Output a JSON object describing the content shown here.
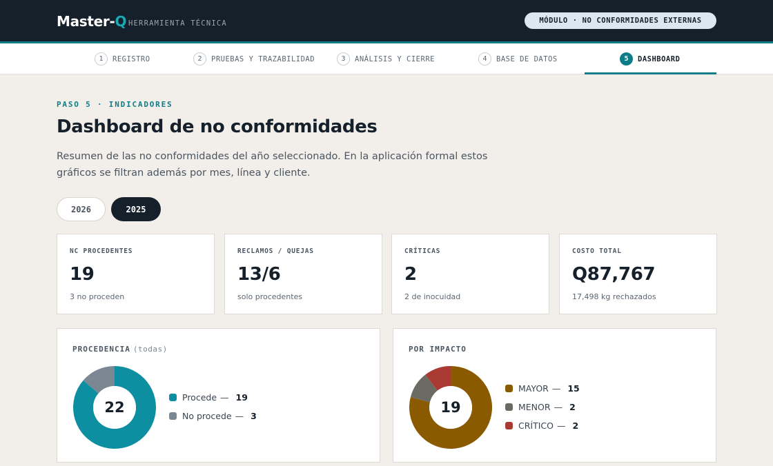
{
  "header": {
    "brand_main": "Master-",
    "brand_q": "Q",
    "brand_sub": "HERRAMIENTA TÉCNICA",
    "module": "MÓDULO · NO CONFORMIDADES EXTERNAS"
  },
  "steps": [
    {
      "num": "1",
      "label": "REGISTRO",
      "active": false
    },
    {
      "num": "2",
      "label": "PRUEBAS Y TRAZABILIDAD",
      "active": false
    },
    {
      "num": "3",
      "label": "ANÁLISIS Y CIERRE",
      "active": false
    },
    {
      "num": "4",
      "label": "BASE DE DATOS",
      "active": false
    },
    {
      "num": "5",
      "label": "DASHBOARD",
      "active": true
    }
  ],
  "page": {
    "eyebrow": "PASO 5 · INDICADORES",
    "title": "Dashboard de no conformidades",
    "description": "Resumen de las no conformidades del año seleccionado. En la aplicación formal estos gráficos se filtran además por mes, línea y cliente."
  },
  "years": [
    {
      "label": "2026",
      "selected": false
    },
    {
      "label": "2025",
      "selected": true
    }
  ],
  "kpis": [
    {
      "label": "NC PROCEDENTES",
      "value": "19",
      "sub": "3 no proceden"
    },
    {
      "label": "RECLAMOS / QUEJAS",
      "value": "13/6",
      "sub": "solo procedentes"
    },
    {
      "label": "CRÍTICAS",
      "value": "2",
      "sub": "2 de inocuidad"
    },
    {
      "label": "COSTO TOTAL",
      "value": "Q87,767",
      "sub": "17,498 kg rechazados"
    }
  ],
  "chart_data": [
    {
      "type": "pie",
      "title": "PROCEDENCIA",
      "title_hint": "(todas)",
      "center_label": "22",
      "slices": [
        {
          "name": "Procede",
          "value": 19,
          "color": "#0e8fa1"
        },
        {
          "name": "No procede",
          "value": 3,
          "color": "#7c8794"
        }
      ]
    },
    {
      "type": "pie",
      "title": "POR IMPACTO",
      "title_hint": "",
      "center_label": "19",
      "slices": [
        {
          "name": "MAYOR",
          "value": 15,
          "color": "#8a5a00"
        },
        {
          "name": "MENOR",
          "value": 2,
          "color": "#6b6a63"
        },
        {
          "name": "CRÍTICO",
          "value": 2,
          "color": "#a83a33"
        }
      ]
    }
  ]
}
